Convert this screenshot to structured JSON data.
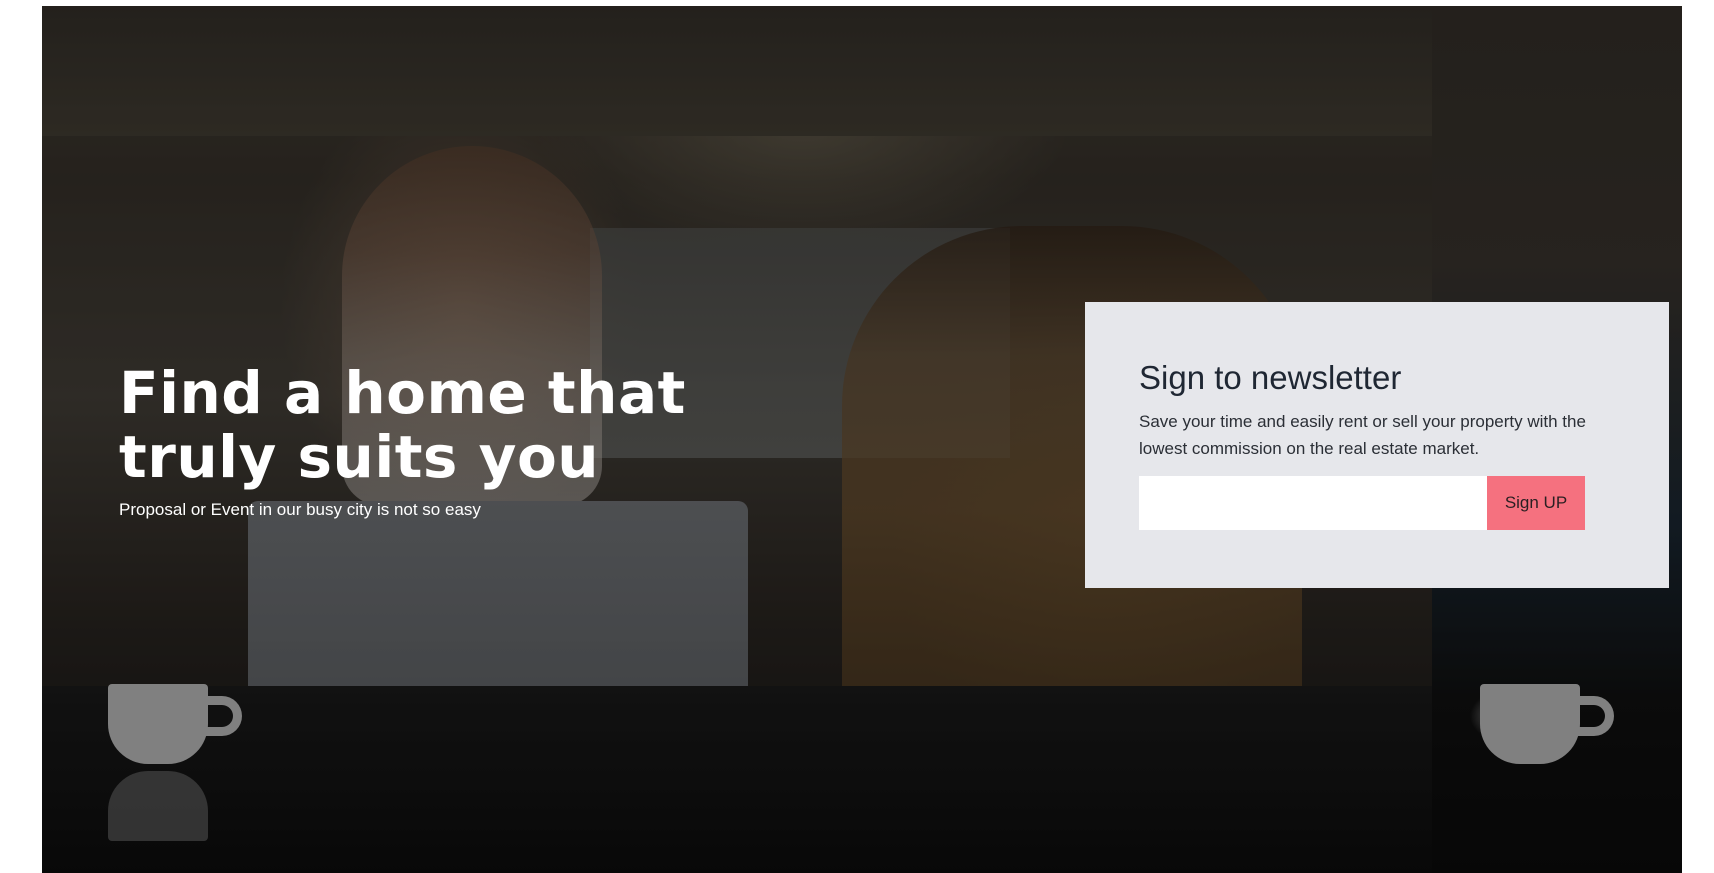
{
  "hero": {
    "headline_line1": "Find a home that",
    "headline_line2": "truly suits you",
    "subtitle": "Proposal or Event in our busy city is not so easy"
  },
  "newsletter": {
    "title": "Sign to newsletter",
    "description": "Save your time and easily rent or sell your property with the lowest commission on the real estate market.",
    "email_value": "",
    "email_placeholder": "",
    "button_label": "Sign UP"
  },
  "colors": {
    "accent": "#f5717f",
    "panel_background": "#e6e7eb",
    "title_text": "#1f2733"
  }
}
